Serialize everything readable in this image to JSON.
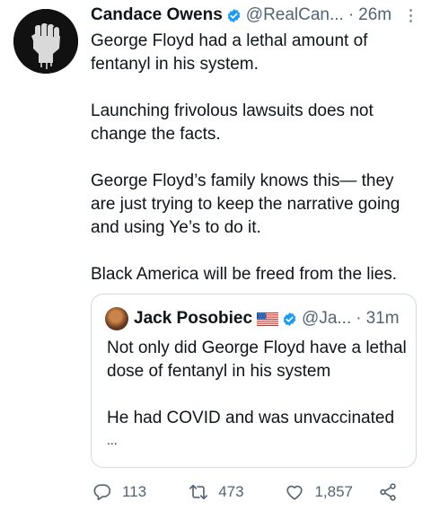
{
  "tweet": {
    "author_name": "Candace Owens",
    "handle": "@RealCan...",
    "separator": "·",
    "time": "26m",
    "paragraphs": [
      "George Floyd had a lethal amount of fentanyl in his system.",
      "Launching frivolous lawsuits does not change the facts.",
      "George Floyd’s family knows this— they are just trying to keep the narrative going and using Ye’s to do it.",
      "Black America will be freed from the lies."
    ]
  },
  "quote": {
    "author_name": "Jack Posobiec",
    "handle": "@Ja...",
    "separator": "·",
    "time": "31m",
    "paragraphs": [
      "Not only did George Floyd have a lethal dose of fentanyl in his system",
      "He had COVID and was unvaccinated",
      "..."
    ]
  },
  "actions": {
    "replies": "113",
    "retweets": "473",
    "likes": "1,857"
  },
  "icons": {
    "verified": "verified-badge-icon",
    "flag": "us-flag-icon",
    "reply": "reply-icon",
    "retweet": "retweet-icon",
    "like": "heart-icon",
    "share": "share-icon",
    "more": "more-options-icon"
  },
  "colors": {
    "text": "#0f1419",
    "secondary": "#536471",
    "verified": "#1d9bf0",
    "border": "#cfd9de"
  }
}
